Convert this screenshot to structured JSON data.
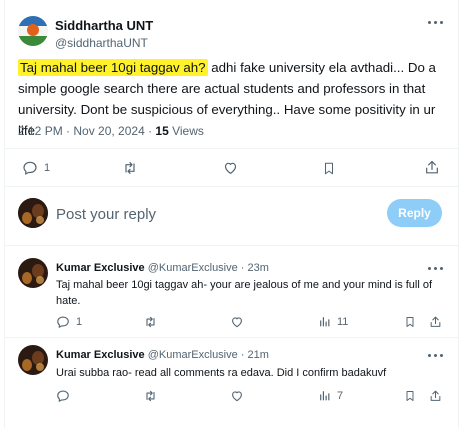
{
  "main_tweet": {
    "author_name": "Siddhartha UNT",
    "author_handle": "@siddharthaUNT",
    "highlighted_text": "Taj mahal beer 10gi taggav ah?",
    "text_rest": " adhi fake university ela avthadi... Do a simple google search there are actual students and professors in that university. Dont be suspicious of everything..  Have some positivity in ur life",
    "timestamp": "2:12 PM · Nov 20, 2024 · ",
    "views_count": "15",
    "views_label": " Views",
    "actions": {
      "reply_count": "1"
    }
  },
  "composer": {
    "placeholder": "Post your reply",
    "reply_button": "Reply"
  },
  "replies": [
    {
      "name": "Kumar Exclusive",
      "handle": "@KumarExclusive",
      "time": " · 23m",
      "text": "Taj mahal beer 10gi taggav ah- your are jealous of me and your mind is full of hate.",
      "reply_count": "1",
      "views": "11"
    },
    {
      "name": "Kumar Exclusive",
      "handle": "@KumarExclusive",
      "time": " · 21m",
      "text": "Urai subba rao- read all comments ra edava. Did I confirm badakuvf",
      "reply_count": "",
      "views": "7"
    }
  ],
  "colors": {
    "highlight": "#fff12a",
    "reply_button": "#8ecdf8",
    "secondary_text": "#536471"
  }
}
